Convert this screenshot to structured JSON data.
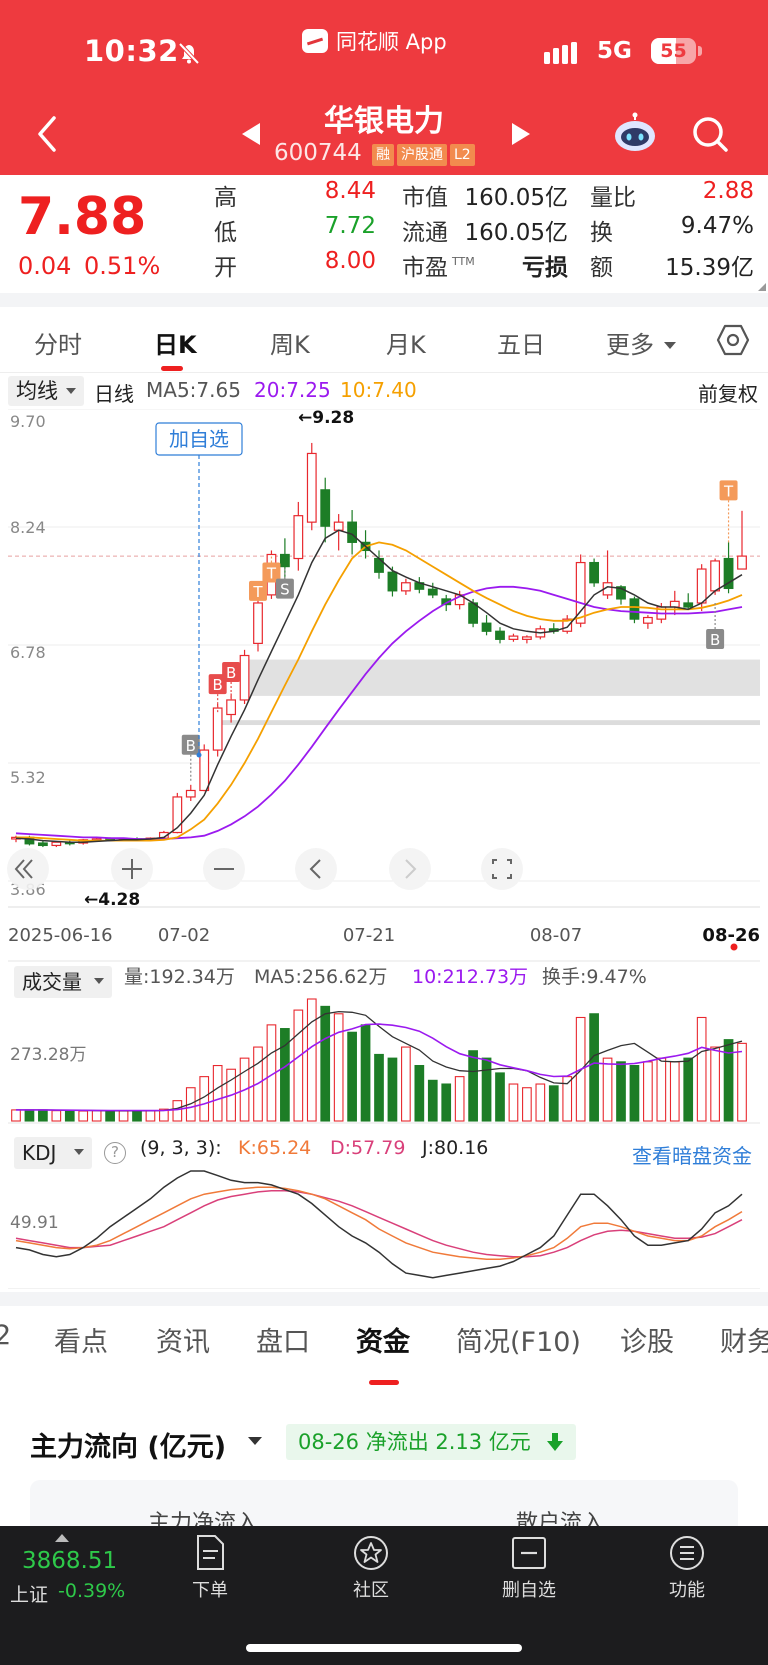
{
  "status_bar": {
    "time": "10:32",
    "app_name": "同花顺 App",
    "network": "5G",
    "battery": "55",
    "battery_level_pct": 55
  },
  "header": {
    "stock_name": "华银电力",
    "stock_code": "600744",
    "tags": [
      "融",
      "沪股通",
      "L2"
    ]
  },
  "quote": {
    "price": "7.88",
    "change": "0.04",
    "change_pct": "0.51%",
    "high_label": "高",
    "high": "8.44",
    "low_label": "低",
    "low": "7.72",
    "open_label": "开",
    "open": "8.00",
    "mktcap_label": "市值",
    "mktcap": "160.05亿",
    "float_label": "流通",
    "float_cap": "160.05亿",
    "pe_label": "市盈",
    "pe_sup": "TTM",
    "pe": "亏损",
    "vol_ratio_label": "量比",
    "vol_ratio": "2.88",
    "turnover_label": "换",
    "turnover": "9.47%",
    "amount_label": "额",
    "amount": "15.39亿"
  },
  "period_tabs": [
    "分时",
    "日K",
    "周K",
    "月K",
    "五日",
    "更多"
  ],
  "active_period": "日K",
  "ma_indicator": {
    "select": "均线",
    "line_type": "日线",
    "ma5": "MA5:7.65",
    "ma20": "20:7.25",
    "ma10": "10:7.40",
    "adjust": "前复权"
  },
  "kline_chart": {
    "y_ticks": [
      "9.70",
      "8.24",
      "6.78",
      "5.32",
      "3.86"
    ],
    "x_ticks": [
      "2025-06-16",
      "07-02",
      "07-21",
      "08-07",
      "08-26"
    ],
    "add_watch_label": "加自选",
    "high_mark": "←9.28",
    "low_mark": "←4.28",
    "signals": [
      "B",
      "B",
      "B",
      "T",
      "T",
      "S",
      "T",
      "B"
    ]
  },
  "chart_data": [
    {
      "type": "candlestick",
      "ylim": [
        3.86,
        9.7
      ],
      "y_ticks": [
        9.7,
        8.24,
        6.78,
        5.32,
        3.86
      ],
      "x_ticks": [
        "2025-06-16",
        "07-02",
        "07-21",
        "08-07",
        "08-26"
      ],
      "candles": [
        {
          "o": 4.38,
          "h": 4.42,
          "l": 4.34,
          "c": 4.4
        },
        {
          "o": 4.4,
          "h": 4.42,
          "l": 4.3,
          "c": 4.32
        },
        {
          "o": 4.33,
          "h": 4.36,
          "l": 4.28,
          "c": 4.3
        },
        {
          "o": 4.3,
          "h": 4.35,
          "l": 4.28,
          "c": 4.34
        },
        {
          "o": 4.34,
          "h": 4.36,
          "l": 4.3,
          "c": 4.33
        },
        {
          "o": 4.33,
          "h": 4.38,
          "l": 4.31,
          "c": 4.37
        },
        {
          "o": 4.37,
          "h": 4.4,
          "l": 4.35,
          "c": 4.38
        },
        {
          "o": 4.38,
          "h": 4.4,
          "l": 4.36,
          "c": 4.37
        },
        {
          "o": 4.37,
          "h": 4.39,
          "l": 4.35,
          "c": 4.38
        },
        {
          "o": 4.38,
          "h": 4.4,
          "l": 4.36,
          "c": 4.37
        },
        {
          "o": 4.37,
          "h": 4.4,
          "l": 4.36,
          "c": 4.39
        },
        {
          "o": 4.39,
          "h": 4.48,
          "l": 4.38,
          "c": 4.46
        },
        {
          "o": 4.46,
          "h": 4.95,
          "l": 4.45,
          "c": 4.9
        },
        {
          "o": 4.9,
          "h": 5.05,
          "l": 4.85,
          "c": 4.98
        },
        {
          "o": 4.98,
          "h": 5.55,
          "l": 4.97,
          "c": 5.48
        },
        {
          "o": 5.48,
          "h": 6.05,
          "l": 5.4,
          "c": 6.0
        },
        {
          "o": 5.92,
          "h": 6.18,
          "l": 5.82,
          "c": 6.1
        },
        {
          "o": 6.1,
          "h": 6.72,
          "l": 6.05,
          "c": 6.65
        },
        {
          "o": 6.8,
          "h": 7.35,
          "l": 6.7,
          "c": 7.3
        },
        {
          "o": 7.4,
          "h": 7.95,
          "l": 7.35,
          "c": 7.9
        },
        {
          "o": 7.9,
          "h": 8.1,
          "l": 7.4,
          "c": 7.75
        },
        {
          "o": 7.85,
          "h": 8.55,
          "l": 7.7,
          "c": 8.38
        },
        {
          "o": 8.3,
          "h": 9.28,
          "l": 8.2,
          "c": 9.15
        },
        {
          "o": 8.7,
          "h": 8.85,
          "l": 8.05,
          "c": 8.25
        },
        {
          "o": 8.2,
          "h": 8.4,
          "l": 7.95,
          "c": 8.3
        },
        {
          "o": 8.3,
          "h": 8.45,
          "l": 7.9,
          "c": 8.05
        },
        {
          "o": 8.05,
          "h": 8.2,
          "l": 7.85,
          "c": 7.95
        },
        {
          "o": 7.85,
          "h": 7.95,
          "l": 7.6,
          "c": 7.68
        },
        {
          "o": 7.68,
          "h": 7.75,
          "l": 7.38,
          "c": 7.45
        },
        {
          "o": 7.45,
          "h": 7.6,
          "l": 7.4,
          "c": 7.55
        },
        {
          "o": 7.55,
          "h": 7.62,
          "l": 7.42,
          "c": 7.47
        },
        {
          "o": 7.47,
          "h": 7.55,
          "l": 7.36,
          "c": 7.4
        },
        {
          "o": 7.35,
          "h": 7.4,
          "l": 7.2,
          "c": 7.28
        },
        {
          "o": 7.28,
          "h": 7.45,
          "l": 7.22,
          "c": 7.4
        },
        {
          "o": 7.3,
          "h": 7.35,
          "l": 7.0,
          "c": 7.05
        },
        {
          "o": 7.05,
          "h": 7.15,
          "l": 6.9,
          "c": 6.95
        },
        {
          "o": 6.95,
          "h": 7.0,
          "l": 6.8,
          "c": 6.85
        },
        {
          "o": 6.85,
          "h": 6.92,
          "l": 6.82,
          "c": 6.89
        },
        {
          "o": 6.85,
          "h": 6.9,
          "l": 6.8,
          "c": 6.88
        },
        {
          "o": 6.88,
          "h": 7.02,
          "l": 6.85,
          "c": 6.98
        },
        {
          "o": 6.98,
          "h": 7.05,
          "l": 6.92,
          "c": 6.95
        },
        {
          "o": 6.95,
          "h": 7.15,
          "l": 6.92,
          "c": 7.1
        },
        {
          "o": 7.05,
          "h": 7.9,
          "l": 7.0,
          "c": 7.8
        },
        {
          "o": 7.8,
          "h": 7.85,
          "l": 7.5,
          "c": 7.55
        },
        {
          "o": 7.4,
          "h": 7.95,
          "l": 7.35,
          "c": 7.55
        },
        {
          "o": 7.5,
          "h": 7.52,
          "l": 7.28,
          "c": 7.35
        },
        {
          "o": 7.35,
          "h": 7.38,
          "l": 7.05,
          "c": 7.1
        },
        {
          "o": 7.05,
          "h": 7.15,
          "l": 6.98,
          "c": 7.12
        },
        {
          "o": 7.1,
          "h": 7.3,
          "l": 7.05,
          "c": 7.25
        },
        {
          "o": 7.25,
          "h": 7.45,
          "l": 7.15,
          "c": 7.32
        },
        {
          "o": 7.3,
          "h": 7.42,
          "l": 7.22,
          "c": 7.25
        },
        {
          "o": 7.3,
          "h": 7.78,
          "l": 7.2,
          "c": 7.72
        },
        {
          "o": 7.45,
          "h": 7.85,
          "l": 7.4,
          "c": 7.82
        },
        {
          "o": 7.85,
          "h": 8.05,
          "l": 7.42,
          "c": 7.48
        },
        {
          "o": 7.72,
          "h": 8.44,
          "l": 7.72,
          "c": 7.88
        }
      ],
      "ma5": [
        4.39,
        4.38,
        4.36,
        4.35,
        4.34,
        4.34,
        4.35,
        4.36,
        4.37,
        4.37,
        4.38,
        4.4,
        4.52,
        4.7,
        4.92,
        5.3,
        5.65,
        5.98,
        6.35,
        6.7,
        7.05,
        7.4,
        7.8,
        8.1,
        8.2,
        8.15,
        8.0,
        7.85,
        7.7,
        7.62,
        7.55,
        7.5,
        7.45,
        7.4,
        7.3,
        7.18,
        7.05,
        6.98,
        6.95,
        6.93,
        6.95,
        7.0,
        7.2,
        7.4,
        7.5,
        7.48,
        7.4,
        7.3,
        7.25,
        7.25,
        7.22,
        7.3,
        7.45,
        7.55,
        7.65
      ],
      "ma10": [
        4.4,
        4.4,
        4.39,
        4.38,
        4.37,
        4.36,
        4.36,
        4.36,
        4.36,
        4.36,
        4.36,
        4.37,
        4.4,
        4.5,
        4.62,
        4.82,
        5.05,
        5.32,
        5.62,
        5.95,
        6.28,
        6.6,
        6.95,
        7.28,
        7.58,
        7.85,
        8.0,
        8.05,
        8.02,
        7.95,
        7.85,
        7.75,
        7.65,
        7.55,
        7.45,
        7.36,
        7.28,
        7.2,
        7.14,
        7.1,
        7.08,
        7.08,
        7.12,
        7.18,
        7.22,
        7.25,
        7.25,
        7.24,
        7.22,
        7.22,
        7.22,
        7.24,
        7.28,
        7.33,
        7.4
      ],
      "ma20": [
        4.45,
        4.44,
        4.43,
        4.42,
        4.41,
        4.4,
        4.4,
        4.39,
        4.39,
        4.38,
        4.38,
        4.38,
        4.39,
        4.4,
        4.42,
        4.48,
        4.56,
        4.66,
        4.78,
        4.93,
        5.1,
        5.3,
        5.52,
        5.75,
        5.98,
        6.2,
        6.42,
        6.62,
        6.8,
        6.95,
        7.08,
        7.2,
        7.3,
        7.38,
        7.44,
        7.48,
        7.5,
        7.5,
        7.48,
        7.45,
        7.4,
        7.35,
        7.3,
        7.25,
        7.22,
        7.2,
        7.19,
        7.18,
        7.17,
        7.17,
        7.17,
        7.18,
        7.19,
        7.22,
        7.25
      ]
    },
    {
      "type": "bar",
      "title": "成交量",
      "value_label": "量:192.34万",
      "ma5_label": "MA5:256.62万",
      "ma10_label": "10:212.73万",
      "turnover_label": "换手:9.47%",
      "y_tick": "273.28万",
      "values": [
        30,
        30,
        30,
        28,
        28,
        27,
        28,
        27,
        27,
        28,
        28,
        32,
        55,
        90,
        120,
        150,
        140,
        170,
        200,
        260,
        250,
        300,
        330,
        310,
        290,
        240,
        260,
        180,
        170,
        200,
        150,
        110,
        100,
        120,
        190,
        170,
        130,
        100,
        90,
        100,
        95,
        120,
        280,
        290,
        170,
        160,
        150,
        160,
        170,
        160,
        170,
        280,
        200,
        220,
        210
      ]
    },
    {
      "type": "line",
      "title": "KDJ",
      "params": "(9, 3, 3):",
      "k_label": "K:65.24",
      "d_label": "D:57.79",
      "j_label": "J:80.16",
      "y_tick": "49.91",
      "k": [
        40,
        38,
        36,
        34,
        33,
        34,
        36,
        40,
        46,
        52,
        58,
        64,
        70,
        76,
        80,
        82,
        84,
        85,
        86,
        86,
        85,
        83,
        80,
        76,
        70,
        64,
        58,
        50,
        44,
        38,
        34,
        30,
        28,
        26,
        25,
        24,
        24,
        25,
        27,
        30,
        34,
        42,
        52,
        55,
        55,
        52,
        48,
        44,
        42,
        40,
        40,
        44,
        52,
        58,
        65
      ],
      "d": [
        42,
        40,
        38,
        36,
        34,
        34,
        35,
        36,
        40,
        44,
        48,
        52,
        58,
        64,
        70,
        75,
        78,
        80,
        82,
        83,
        83,
        82,
        80,
        77,
        74,
        70,
        65,
        60,
        55,
        50,
        45,
        40,
        36,
        33,
        30,
        28,
        27,
        26,
        26,
        27,
        30,
        34,
        40,
        45,
        48,
        49,
        48,
        46,
        44,
        42,
        42,
        43,
        46,
        52,
        58
      ],
      "j": [
        34,
        32,
        28,
        26,
        28,
        34,
        42,
        52,
        60,
        68,
        76,
        86,
        94,
        100,
        100,
        96,
        92,
        90,
        90,
        88,
        84,
        80,
        72,
        62,
        52,
        44,
        38,
        30,
        20,
        12,
        10,
        8,
        10,
        12,
        14,
        16,
        18,
        22,
        28,
        34,
        44,
        62,
        80,
        80,
        70,
        58,
        44,
        36,
        36,
        38,
        40,
        50,
        64,
        70,
        80
      ]
    }
  ],
  "volume_panel": {
    "select": "成交量",
    "value": "量:192.34万",
    "ma5": "MA5:256.62万",
    "ma10": "10:212.73万",
    "turnover": "换手:9.47%",
    "y_tick": "273.28万"
  },
  "kdj_panel": {
    "select": "KDJ",
    "help": "?",
    "params": "(9, 3, 3):",
    "k": "K:65.24",
    "d": "D:57.79",
    "j": "J:80.16",
    "y_tick": "49.91",
    "link": "查看暗盘资金"
  },
  "bottom_tabs": [
    "2",
    "看点",
    "资讯",
    "盘口",
    "资金",
    "简况(F10)",
    "诊股",
    "财务"
  ],
  "active_bottom_tab": "资金",
  "fund_flow": {
    "title": "主力流向 (亿元)",
    "badge": "08-26 净流出 2.13 亿元",
    "col1": "主力净流入",
    "col2": "散户流入"
  },
  "bottom_nav": {
    "index_value": "3868.51",
    "index_name": "上证",
    "index_change": "-0.39%",
    "items": [
      {
        "label": "下单",
        "icon": "order-icon"
      },
      {
        "label": "社区",
        "icon": "community-icon"
      },
      {
        "label": "删自选",
        "icon": "remove-watch-icon"
      },
      {
        "label": "功能",
        "icon": "menu-icon"
      }
    ]
  },
  "colors": {
    "brand_red": "#ee3a3f",
    "up": "#e8282e",
    "down": "#1d7d26",
    "ma5": "#333333",
    "ma10": "#f5a000",
    "ma20": "#9b1aef",
    "k": "#333333",
    "d": "#f07a3a",
    "j": "#d9407a",
    "link": "#2f7ed8"
  }
}
